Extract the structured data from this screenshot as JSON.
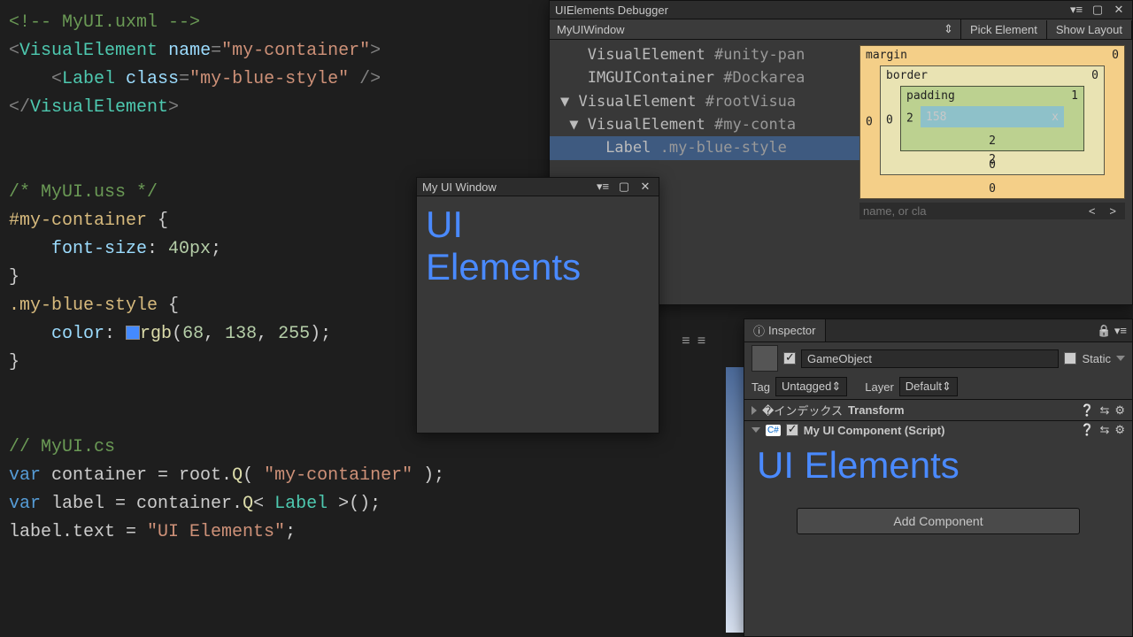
{
  "code": {
    "uxml_comment": "<!-- MyUI.uxml -->",
    "uxml_l1a": "<",
    "uxml_l1_tag": "VisualElement",
    "uxml_l1_sp": " ",
    "uxml_l1_attr": "name",
    "uxml_l1_eq": "=",
    "uxml_l1_val": "\"my-container\"",
    "uxml_l1b": ">",
    "uxml_l2a": "    <",
    "uxml_l2_tag": "Label",
    "uxml_l2_sp": " ",
    "uxml_l2_attr": "class",
    "uxml_l2_eq": "=",
    "uxml_l2_val": "\"my-blue-style\"",
    "uxml_l2b": " />",
    "uxml_l3a": "</",
    "uxml_l3_tag": "VisualElement",
    "uxml_l3b": ">",
    "uss_comment": "/* MyUI.uss */",
    "uss_sel1": "#my-container",
    "uss_b1": " {",
    "uss_p1": "    font-size",
    "uss_c1": ": ",
    "uss_v1": "40px",
    "uss_e1": ";",
    "uss_b1c": "}",
    "uss_sel2": ".my-blue-style",
    "uss_b2": " {",
    "uss_p2": "    color",
    "uss_c2": ": ",
    "uss_fn": "rgb",
    "uss_paren": "(",
    "uss_r": "68",
    "uss_cm1": ", ",
    "uss_g": "138",
    "uss_cm2": ", ",
    "uss_bl": "255",
    "uss_paren2": ")",
    "uss_e2": ";",
    "uss_b2c": "}",
    "cs_comment": "// MyUI.cs",
    "cs_l1_kw": "var",
    "cs_l1_a": " container = root.",
    "cs_l1_fn": "Q",
    "cs_l1_b": "( ",
    "cs_l1_str": "\"my-container\"",
    "cs_l1_c": " );",
    "cs_l2_kw": "var",
    "cs_l2_a": " label = container.",
    "cs_l2_fn": "Q",
    "cs_l2_b": "< ",
    "cs_l2_type": "Label",
    "cs_l2_c": " >();",
    "cs_l3_a": "label.text = ",
    "cs_l3_str": "\"UI Elements\"",
    "cs_l3_b": ";"
  },
  "myui": {
    "title": "My UI Window",
    "text": "UI\nElements"
  },
  "debugger": {
    "title": "UIElements Debugger",
    "dropdown": "MyUIWindow",
    "pick": "Pick Element",
    "layout": "Show Layout",
    "tree": [
      {
        "indent": "  ",
        "expander": " ",
        "type": "VisualElement",
        "sel": "#unity-pan"
      },
      {
        "indent": "  ",
        "expander": " ",
        "type": "IMGUIContainer",
        "sel": "#Dockarea"
      },
      {
        "indent": "",
        "expander": "▼ ",
        "type": "VisualElement",
        "sel": "#rootVisua"
      },
      {
        "indent": " ",
        "expander": "▼ ",
        "type": "VisualElement",
        "sel": "#my-conta"
      },
      {
        "indent": "     ",
        "expander": "",
        "type": "Label",
        "sel": ".my-blue-style",
        "selected": true
      }
    ],
    "box": {
      "margin": {
        "label": "margin",
        "top": "0",
        "right": "",
        "bottom": "0",
        "left": "0"
      },
      "border": {
        "label": "border",
        "top": "0",
        "right": "",
        "bottom": "0",
        "left": "0"
      },
      "padding": {
        "label": "padding",
        "top": "1",
        "right": "",
        "bottom": "2",
        "left": "2"
      },
      "content_w": "158",
      "content_x": "x",
      "content_h": "2",
      "trail": "2"
    },
    "search_ph": "name, or cla"
  },
  "mid": {
    "prefs": "≡",
    "eq": "≡"
  },
  "inspector": {
    "tab": "Inspector",
    "go_name": "GameObject",
    "static": "Static",
    "tag_lbl": "Tag",
    "tag_val": "Untagged",
    "layer_lbl": "Layer",
    "layer_val": "Default",
    "comp_transform": "Transform",
    "comp_script": "My UI Component (Script)",
    "big_text": "UI Elements",
    "add": "Add Component"
  }
}
